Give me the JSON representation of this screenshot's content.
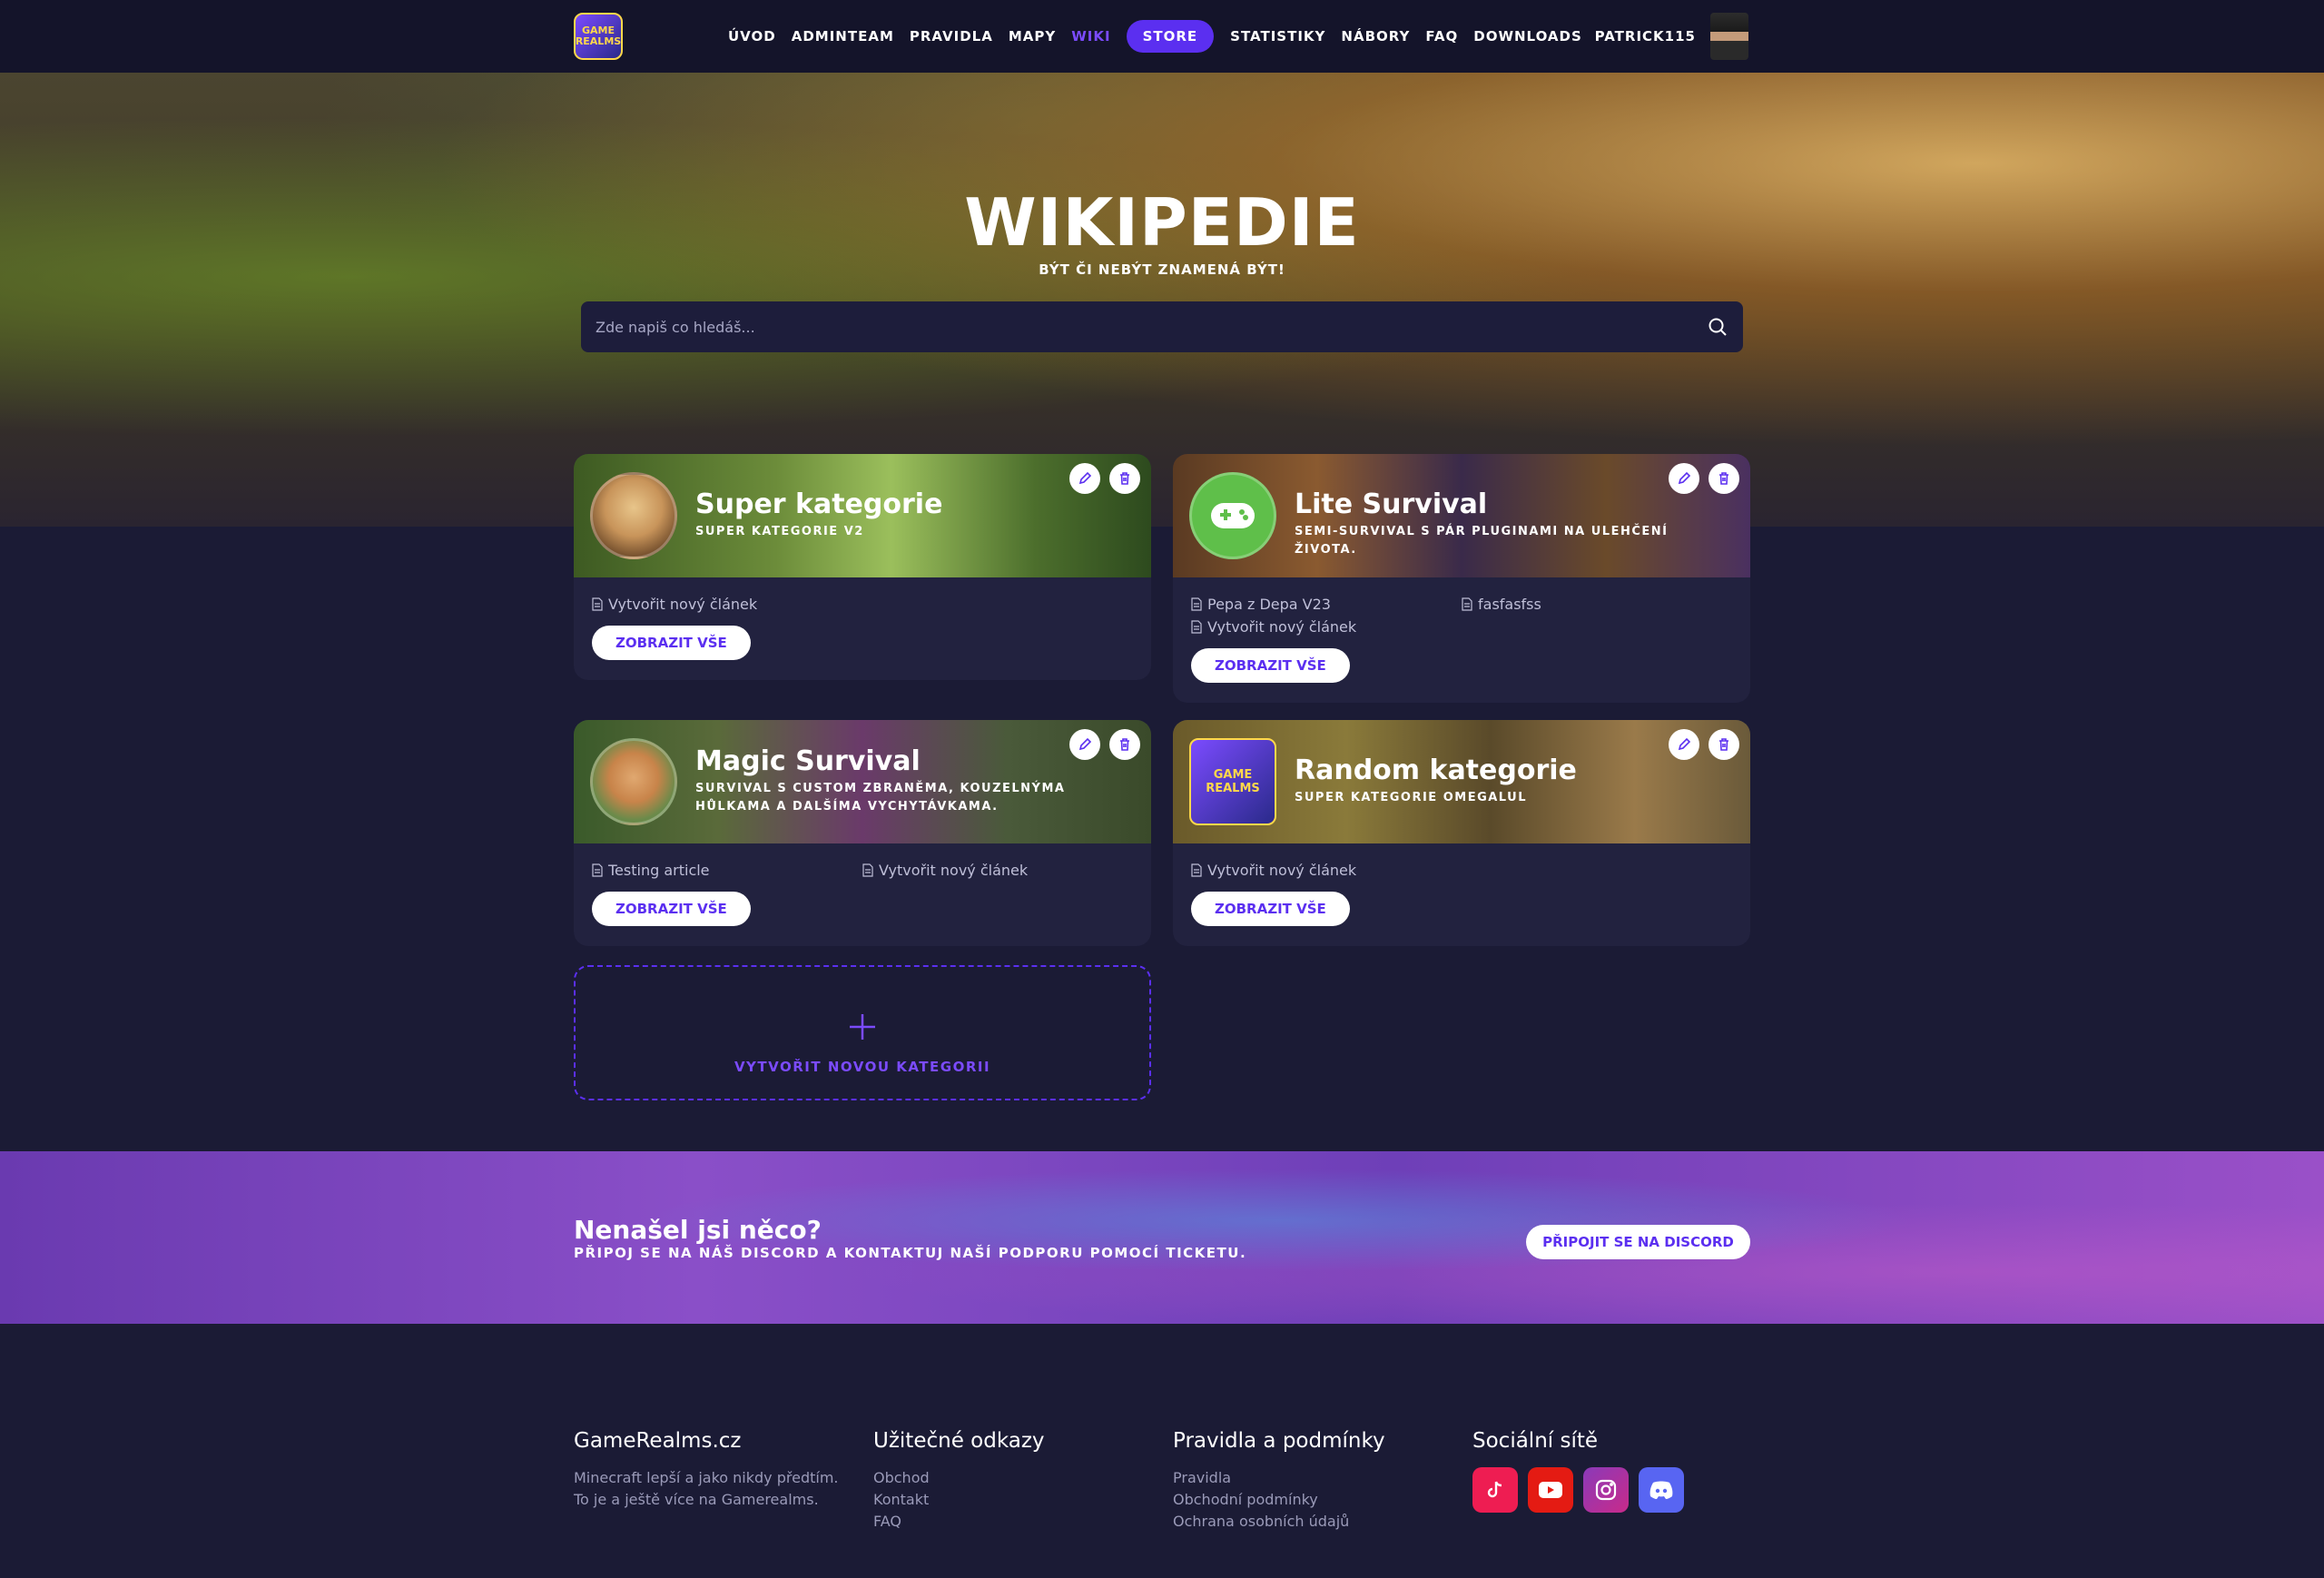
{
  "nav": {
    "logo_text": "GAME REALMS",
    "items": [
      {
        "label": "ÚVOD"
      },
      {
        "label": "ADMINTEAM"
      },
      {
        "label": "PRAVIDLA"
      },
      {
        "label": "MAPY"
      },
      {
        "label": "WIKI",
        "active": true
      },
      {
        "label": "STORE",
        "highlight": true
      },
      {
        "label": "STATISTIKY"
      },
      {
        "label": "NÁBORY"
      },
      {
        "label": "FAQ"
      },
      {
        "label": "DOWNLOADS"
      }
    ],
    "user": "PATRICK115"
  },
  "hero": {
    "title": "WIKIPEDIE",
    "subtitle": "BÝT ČI NEBÝT ZNAMENÁ BÝT!",
    "search_placeholder": "Zde napiš co hledáš..."
  },
  "categories": [
    {
      "title": "Super kategorie",
      "description": "SUPER KATEGORIE V2",
      "articles": [
        "Vytvořit nový článek"
      ],
      "button": "ZOBRAZIT VŠE"
    },
    {
      "title": "Lite Survival",
      "description": "SEMI-SURVIVAL S PÁR PLUGINAMI NA ULEHČENÍ ŽIVOTA.",
      "articles": [
        "Pepa z Depa V23",
        "fasfasfss",
        "Vytvořit nový článek"
      ],
      "button": "ZOBRAZIT VŠE"
    },
    {
      "title": "Magic Survival",
      "description": "SURVIVAL S CUSTOM ZBRANĚMA, KOUZELNÝMA HŮLKAMA A DALŠÍMA VYCHYTÁVKAMA.",
      "articles": [
        "Testing article",
        "Vytvořit nový článek"
      ],
      "button": "ZOBRAZIT VŠE"
    },
    {
      "title": "Random kategorie",
      "description": "SUPER KATEGORIE OMEGALUL",
      "articles": [
        "Vytvořit nový článek"
      ],
      "button": "ZOBRAZIT VŠE"
    }
  ],
  "new_category": "VYTVOŘIT NOVOU KATEGORII",
  "banner": {
    "title": "Nenašel jsi něco?",
    "subtitle": "PŘIPOJ SE NA NÁŠ DISCORD A KONTAKTUJ NAŠÍ PODPORU POMOCÍ TICKETU.",
    "button": "PŘIPOJIT SE NA DISCORD"
  },
  "footer": {
    "col1": {
      "title": "GameRealms.cz",
      "line1": "Minecraft lepší a jako nikdy předtím.",
      "line2": "To je a ještě více na Gamerealms."
    },
    "col2": {
      "title": "Užitečné odkazy",
      "links": [
        "Obchod",
        "Kontakt",
        "FAQ"
      ]
    },
    "col3": {
      "title": "Pravidla a podmínky",
      "links": [
        "Pravidla",
        "Obchodní podmínky",
        "Ochrana osobních údajů"
      ]
    },
    "col4": {
      "title": "Sociální sítě",
      "icons": [
        "tiktok-icon",
        "youtube-icon",
        "instagram-icon",
        "discord-icon"
      ]
    }
  },
  "colors": {
    "accent": "#5b2ff0",
    "accent_light": "#7b4bff",
    "bg": "#1b1b35",
    "card": "#22223f"
  }
}
